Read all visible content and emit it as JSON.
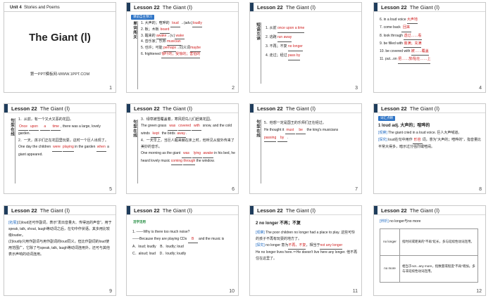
{
  "slides": [
    {
      "num": "1",
      "unit_label": "Unit 4",
      "unit_title": "Stories and Poems",
      "title": "The Giant (Ⅰ)",
      "subtitle": "第一PPT模板网-WWW.1PPT.COM"
    },
    {
      "num": "2",
      "lesson": "Lesson 22",
      "title": "The Giant (Ⅰ)",
      "tag": "课前自主预习",
      "side": "单词闯关",
      "lines": [
        {
          "n": "1.",
          "cn": "大声的；喧哗的",
          "ans": "loud",
          "extra": "→(adv.)",
          "ans2": "loudly"
        },
        {
          "n": "2.",
          "cn": "板；木板",
          "ans": "board",
          "extra": "",
          "ans2": ""
        },
        {
          "n": "3.",
          "cn": "醒来的",
          "ans": "awake",
          "extra": "→(v.)",
          "ans2": "wake"
        },
        {
          "n": "4.",
          "cn": "音乐家；乐师",
          "ans": "musician",
          "extra": "",
          "ans2": ""
        },
        {
          "n": "5.",
          "cn": "也许；可能",
          "ans": "perhaps",
          "extra": "→同义词",
          "ans2": "maybe"
        },
        {
          "n": "6.",
          "cn": "frightened",
          "ans": "惊吓的；受惊的；害怕的",
          "extra": "",
          "ans2": ""
        }
      ]
    },
    {
      "num": "3",
      "lesson": "Lesson 22",
      "title": "The Giant (Ⅰ)",
      "side": "短语互译",
      "lines": [
        {
          "n": "1.",
          "cn": "从前",
          "ans": "once upon a time"
        },
        {
          "n": "2.",
          "cn": "逃跑",
          "ans": "run away"
        },
        {
          "n": "3.",
          "cn": "不再；不复",
          "ans": "no longer"
        },
        {
          "n": "4.",
          "cn": "走过；经过",
          "ans": "pass by"
        }
      ]
    },
    {
      "num": "4",
      "lesson": "Lesson 22",
      "title": "The Giant (Ⅰ)",
      "lines": [
        {
          "n": "6.",
          "en": "in a loud voice",
          "ans": "大声地"
        },
        {
          "n": "7.",
          "en": "come back",
          "ans": "回来"
        },
        {
          "n": "8.",
          "en": "look through",
          "ans": "透过……看"
        },
        {
          "n": "9.",
          "en": "be filled with",
          "ans": "装满；充满"
        },
        {
          "n": "10.",
          "en": "be covered with",
          "ans": "被……覆盖"
        },
        {
          "n": "11.",
          "en": "put...on",
          "ans": "把……放/贴在……上"
        }
      ]
    },
    {
      "num": "5",
      "lesson": "Lesson 22",
      "title": "The Giant (Ⅰ)",
      "side": "句型在线",
      "q1_cn": "1．从前，有一个又大又恶的花园。",
      "q1_a": "Once",
      "q1_b": "upon",
      "q1_c": "a",
      "q1_d": "time",
      "q1_tail": "there was a large, lovely garden.",
      "q2_cn": "2．一天，孩子们正在花园里玩耍，这时一个巨人出现了。",
      "q2_pre": "One day the children",
      "q2_a": "were",
      "q2_b": "playing",
      "q2_mid": "in the garden",
      "q2_c": "when",
      "q2_tail": "a giant appeared."
    },
    {
      "num": "6",
      "lesson": "Lesson 22",
      "title": "The Giant (Ⅰ)",
      "side": "句型在线",
      "q3_cn": "3．绿草被雪覆盖着，寒风把鸟儿们赶离花园。",
      "q3_pre": "The green grass",
      "q3_a": "was",
      "q3_b": "covered",
      "q3_c": "with",
      "q3_mid": "snow, and the cold winds",
      "q3_d": "kept",
      "q3_e": "the birds",
      "q3_f": "away",
      "q4_cn": "4．一天早上，当巨人醒来躺在床上时，他听见从窗外传来了美妙的音乐。",
      "q4_pre": "One morning as the giant",
      "q4_a": "was",
      "q4_b": "lying",
      "q4_c": "awake",
      "q4_mid": "in his bed, he heard lovely music",
      "q4_d": "coming",
      "q4_e": "through",
      "q4_tail": "the window."
    },
    {
      "num": "7",
      "lesson": "Lesson 22",
      "title": "The Giant (Ⅰ)",
      "side": "句型在线",
      "q5_cn": "5．他想一定是国王的乐师们正在经过。",
      "q5_pre": "He thought it",
      "q5_a": "must",
      "q5_b": "be",
      "q5_mid": "the king's musicians",
      "q5_c": "passing",
      "q5_d": "by"
    },
    {
      "num": "8",
      "lesson": "Lesson 22",
      "title": "The Giant (Ⅰ)",
      "tag": "词汇点睛",
      "point": "1  loud  adj.  大声的；喧哗的",
      "ex_label": "[观察]",
      "ex_text": "The giant cried in a loud voice. 巨人大声喊道。",
      "ex2_label": "[探究]",
      "ex2_text": "loud在句中用作",
      "ex2_a": "形容",
      "ex2_mid": "词，意为“大声的；喧哗的”，指音量比平常大得多，暗示过分强烈或喧闹。"
    },
    {
      "num": "9",
      "lesson": "Lesson 22",
      "title": "The Giant (Ⅰ)",
      "p1_label": "[拓展]",
      "p1": "(1)loud还可作副词，表示“发出音量大、传得远的声音”，用于speak, talk, shout, laugh等动词之后，在句中作状语。其多用比较级louder。",
      "p2": "(2)loudly只用作副词与用作副词的loud同义，但比作副词的loud使用范围广，它除了与speak, talk, laugh等动词连用外，还可与其他表示声响的动词连用。"
    },
    {
      "num": "10",
      "lesson": "Lesson 22",
      "title": "The Giant (Ⅰ)",
      "tag": "活学活用",
      "q": "1.  ——Why is there too much noise?",
      "q_b": "——Because they are playing CDs",
      "q_ans": "B",
      "q_tail": "and the music is",
      "opt_a": "A．loud; loudly",
      "opt_b": "B．loudly; loud",
      "opt_c": "C．aloud; loud",
      "opt_d": "D．loudly; loudly"
    },
    {
      "num": "11",
      "lesson": "Lesson 22",
      "title": "The Giant (Ⅰ)",
      "point": "2    no longer  不再；不复",
      "ex_label": "[观察]",
      "ex_text": "The poor children no longer had a place to play. 这些可怜的孩子不再有玩耍的地方了。",
      "ex2_label": "[探究]",
      "ex2_pre": "no longer 意为",
      "ex2_a": "不再，不复",
      "ex2_mid": "，相当于",
      "ex2_b": "not any longer",
      "ex3": "He no longer lives here.＝He doesn't live here any longer. 他不再住在这里了。"
    },
    {
      "num": "12",
      "lesson": "Lesson 22",
      "title": "The Giant (Ⅰ)",
      "lbl": "[辨析]",
      "lbl_text": "no longer与no more",
      "rows": [
        {
          "k": "no longer",
          "v": "指时间或距离的“不再”延长，多与延续性动词连用。"
        },
        {
          "k": "no more",
          "v": "相当于not...any more，指数量或程度“不再”增加。多与非延续性动词连用。"
        }
      ]
    }
  ]
}
